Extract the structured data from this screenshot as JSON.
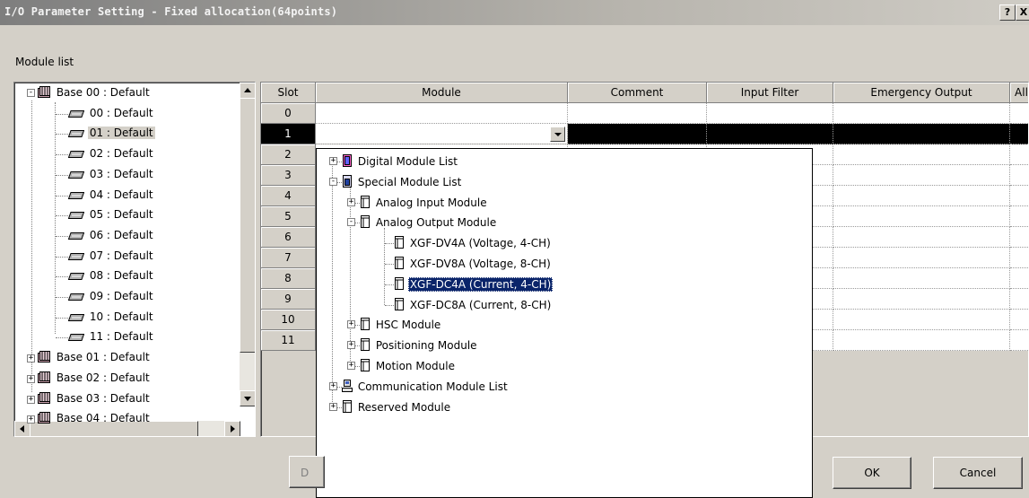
{
  "window": {
    "title": "I/O Parameter Setting - Fixed allocation(64points)",
    "help_label": "?",
    "close_label": "X"
  },
  "module_list_label": "Module list",
  "base_tree": {
    "root": "Base 00 : Default",
    "slots": [
      "00 : Default",
      "01 : Default",
      "02 : Default",
      "03 : Default",
      "04 : Default",
      "05 : Default",
      "06 : Default",
      "07 : Default",
      "08 : Default",
      "09 : Default",
      "10 : Default",
      "11 : Default"
    ],
    "selected_slot": "01 : Default",
    "other_bases": [
      "Base 01 : Default",
      "Base 02 : Default",
      "Base 03 : Default",
      "Base 04 : Default"
    ]
  },
  "grid": {
    "columns": [
      "Slot",
      "Module",
      "Comment",
      "Input Filter",
      "Emergency Output",
      "All"
    ],
    "slots": [
      "0",
      "1",
      "2",
      "3",
      "4",
      "5",
      "6",
      "7",
      "8",
      "9",
      "10",
      "11"
    ],
    "current_slot": "1"
  },
  "module_dropdown": {
    "items": [
      {
        "label": "Digital Module List",
        "level": 0,
        "expander": "+"
      },
      {
        "label": "Special Module List",
        "level": 0,
        "expander": "-"
      },
      {
        "label": "Analog Input Module",
        "level": 1,
        "expander": "+"
      },
      {
        "label": "Analog Output Module",
        "level": 1,
        "expander": "-"
      },
      {
        "label": "XGF-DV4A (Voltage, 4-CH)",
        "level": 2,
        "expander": ""
      },
      {
        "label": "XGF-DV8A (Voltage, 8-CH)",
        "level": 2,
        "expander": ""
      },
      {
        "label": "XGF-DC4A (Current, 4-CH)",
        "level": 2,
        "expander": "",
        "selected": true
      },
      {
        "label": "XGF-DC8A (Current, 8-CH)",
        "level": 2,
        "expander": ""
      },
      {
        "label": "HSC Module",
        "level": 1,
        "expander": "+"
      },
      {
        "label": "Positioning Module",
        "level": 1,
        "expander": "+"
      },
      {
        "label": "Motion Module",
        "level": 1,
        "expander": "+"
      },
      {
        "label": "Communication Module List",
        "level": 0,
        "expander": "+"
      },
      {
        "label": "Reserved Module",
        "level": 0,
        "expander": "+"
      }
    ]
  },
  "buttons": {
    "details_partial": "D",
    "ok": "OK",
    "cancel": "Cancel"
  },
  "colors": {
    "selection": "#0a246a",
    "dialog_bg": "#d4d0c8"
  }
}
